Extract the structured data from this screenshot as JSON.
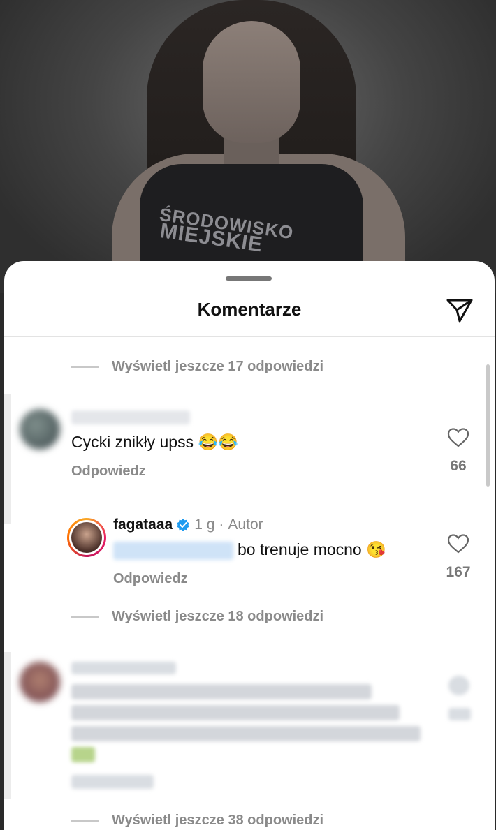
{
  "sheet": {
    "title": "Komentarze"
  },
  "threads": [
    {
      "more_replies": "Wyświetl jeszcze 17 odpowiedzi"
    },
    {
      "more_replies": "Wyświetl jeszcze 18 odpowiedzi"
    },
    {
      "more_replies": "Wyświetl jeszcze 38 odpowiedzi"
    }
  ],
  "comment1": {
    "text": "Cycki znikły upss 😂😂",
    "reply_label": "Odpowiedz",
    "likes": "66"
  },
  "reply1": {
    "username": "fagataaa",
    "time": "1 g",
    "separator": "·",
    "author_label": "Autor",
    "text": "bo trenuje mocno 😘",
    "reply_label": "Odpowiedz",
    "likes": "167"
  },
  "icons": {
    "send": "paper-plane-icon",
    "like": "heart-outline-icon",
    "verified": "verified-badge-icon"
  },
  "colors": {
    "verified": "#1d9bf0",
    "muted": "#8a8a8a"
  }
}
